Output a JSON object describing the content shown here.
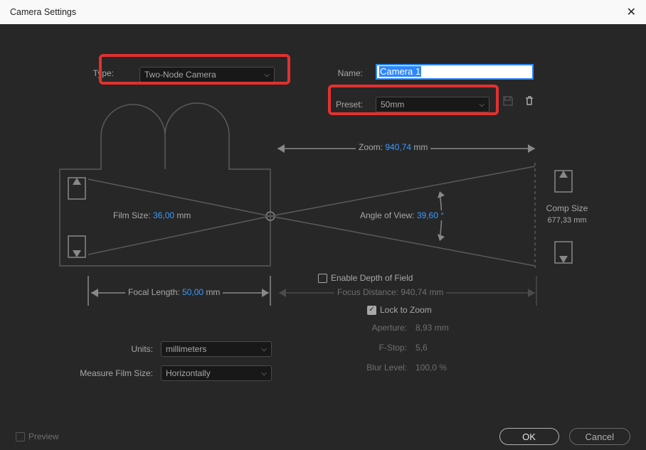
{
  "title": "Camera Settings",
  "type": {
    "label": "Type:",
    "value": "Two-Node Camera"
  },
  "name": {
    "label": "Name:",
    "value": "Camera 1"
  },
  "preset": {
    "label": "Preset:",
    "value": "50mm"
  },
  "diagram": {
    "zoom": {
      "label": "Zoom:",
      "value": "940,74",
      "unit": "mm"
    },
    "film_size": {
      "label": "Film Size:",
      "value": "36,00",
      "unit": "mm"
    },
    "angle_of_view": {
      "label": "Angle of View:",
      "value": "39,60",
      "unit": "°"
    },
    "comp_size": {
      "label": "Comp Size",
      "value": "677,33",
      "unit": "mm"
    },
    "focal_length": {
      "label": "Focal Length:",
      "value": "50,00",
      "unit": "mm"
    },
    "focus_distance": {
      "label": "Focus Distance:",
      "value": "940,74",
      "unit": "mm"
    }
  },
  "depth_of_field": {
    "enable": {
      "label": "Enable Depth of Field",
      "checked": false
    },
    "lock_zoom": {
      "label": "Lock to Zoom",
      "checked": true
    },
    "aperture": {
      "label": "Aperture:",
      "value": "8,93",
      "unit": "mm"
    },
    "fstop": {
      "label": "F-Stop:",
      "value": "5,6"
    },
    "blur": {
      "label": "Blur Level:",
      "value": "100,0",
      "unit": "%"
    }
  },
  "units": {
    "label": "Units:",
    "value": "millimeters"
  },
  "measure_film": {
    "label": "Measure Film Size:",
    "value": "Horizontally"
  },
  "preview_label": "Preview",
  "ok_label": "OK",
  "cancel_label": "Cancel"
}
